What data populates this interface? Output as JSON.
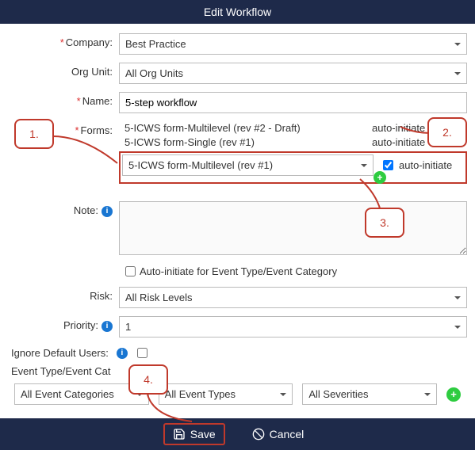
{
  "title": "Edit Workflow",
  "labels": {
    "company": "Company:",
    "orgunit": "Org Unit:",
    "name": "Name:",
    "forms": "Forms:",
    "note": "Note:",
    "auto_event": "Auto-initiate for Event Type/Event Category",
    "risk": "Risk:",
    "priority": "Priority:",
    "ignore": "Ignore Default Users:",
    "section": "Event Type/Event Cat"
  },
  "values": {
    "company": "Best Practice",
    "orgunit": "All Org Units",
    "name": "5-step workflow",
    "risk": "All Risk Levels",
    "priority": "1",
    "filter_cat": "All Event Categories",
    "filter_type": "All Event Types",
    "filter_sev": "All Severities"
  },
  "forms_existing": [
    {
      "name": "5-ICWS form-Multilevel (rev #2 - Draft)",
      "auto": "auto-initiate"
    },
    {
      "name": "5-ICWS form-Single (rev #1)",
      "auto": "auto-initiate"
    }
  ],
  "forms_add": {
    "select": "5-ICWS form-Multilevel (rev #1)",
    "chk_label": "auto-initiate"
  },
  "footer": {
    "save": "Save",
    "cancel": "Cancel"
  },
  "callouts": {
    "c1": "1.",
    "c2": "2.",
    "c3": "3.",
    "c4": "4."
  }
}
